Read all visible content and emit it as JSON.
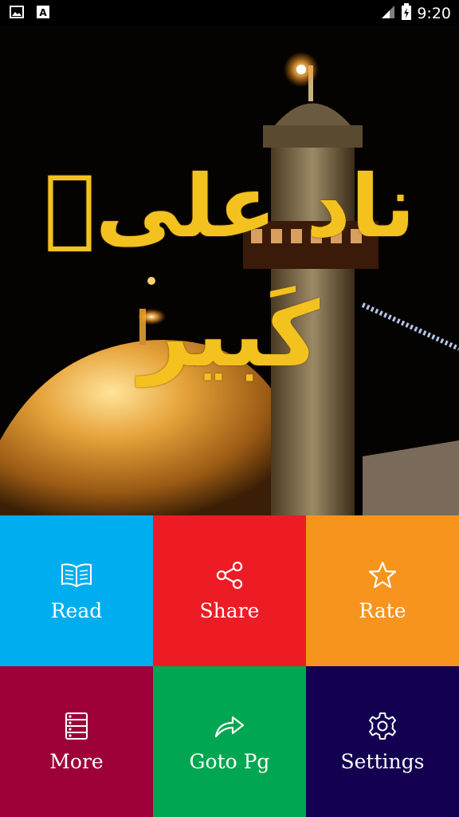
{
  "status_bar": {
    "time": "9:20",
    "left_icons": [
      "image-notification-icon",
      "font-notification-icon"
    ],
    "right_icons": [
      "signal-icon",
      "battery-icon"
    ]
  },
  "hero": {
    "title_line1": "ناد علیؑ",
    "title_line2": "کَبیر",
    "title_color": "#f3c21f"
  },
  "menu": {
    "read": {
      "label": "Read",
      "icon": "book-icon",
      "color": "#00aeef"
    },
    "share": {
      "label": "Share",
      "icon": "share-icon",
      "color": "#ed1c24"
    },
    "rate": {
      "label": "Rate",
      "icon": "star-icon",
      "color": "#f7941d"
    },
    "more": {
      "label": "More",
      "icon": "list-icon",
      "color": "#9e0039"
    },
    "goto": {
      "label": "Goto Pg",
      "icon": "forward-arrow-icon",
      "color": "#00a651"
    },
    "settings": {
      "label": "Settings",
      "icon": "gear-icon",
      "color": "#130050"
    }
  }
}
